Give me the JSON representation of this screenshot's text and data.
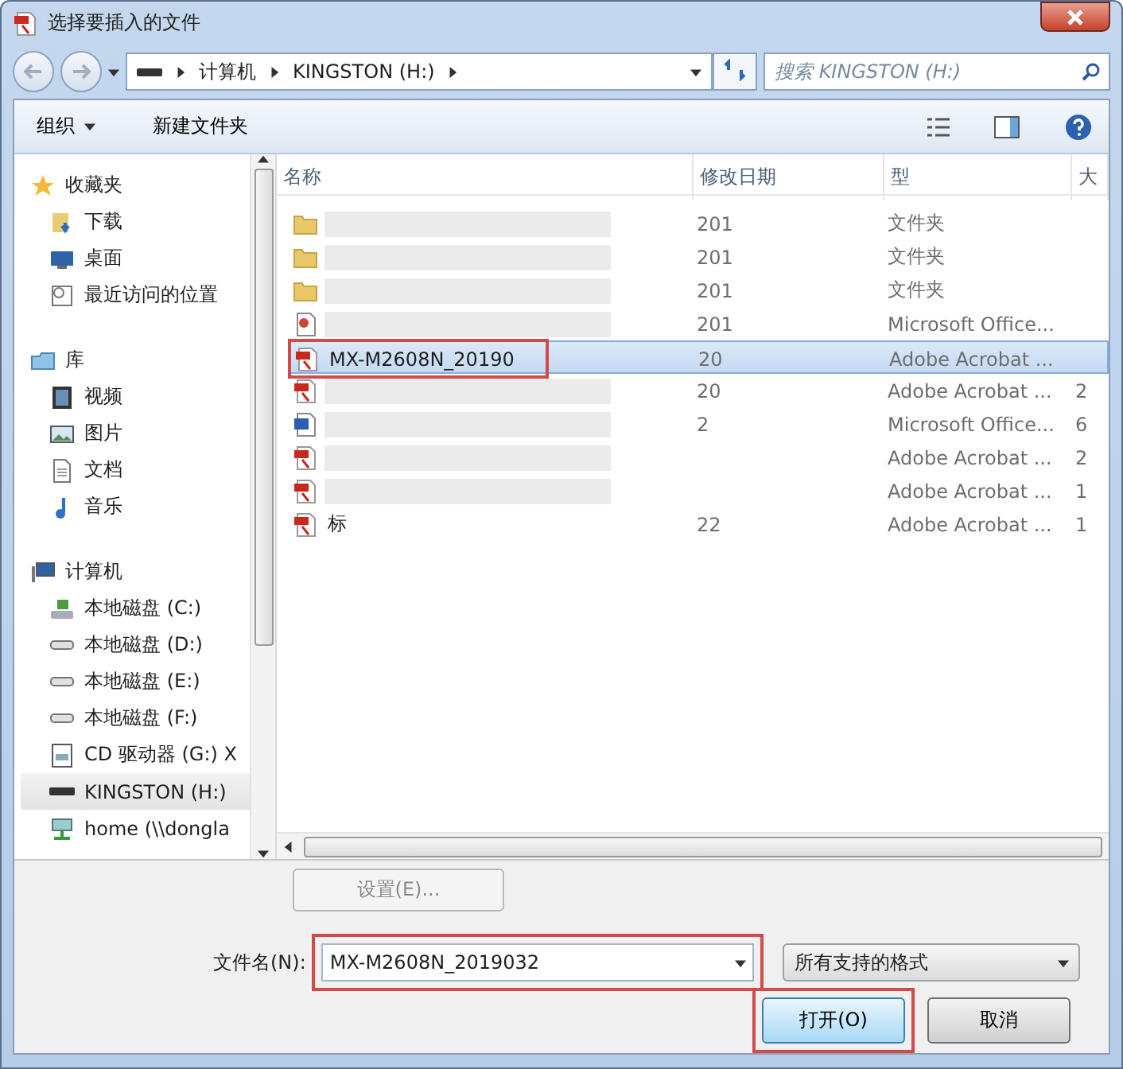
{
  "window": {
    "title": "选择要插入的文件"
  },
  "address": {
    "segments": [
      "计算机",
      "KINGSTON (H:)"
    ]
  },
  "search": {
    "placeholder": "搜索 KINGSTON (H:)"
  },
  "toolbar": {
    "organize": "组织",
    "new_folder": "新建文件夹"
  },
  "sidebar": {
    "groups": [
      {
        "label": "收藏夹",
        "kind": "star",
        "children": [
          {
            "label": "下载",
            "kind": "download",
            "selected": false
          },
          {
            "label": "桌面",
            "kind": "desktop",
            "selected": false
          },
          {
            "label": "最近访问的位置",
            "kind": "recent",
            "selected": false
          }
        ]
      },
      {
        "label": "库",
        "kind": "library",
        "children": [
          {
            "label": "视频",
            "kind": "video",
            "selected": false
          },
          {
            "label": "图片",
            "kind": "picture",
            "selected": false
          },
          {
            "label": "文档",
            "kind": "document",
            "selected": false
          },
          {
            "label": "音乐",
            "kind": "music",
            "selected": false
          }
        ]
      },
      {
        "label": "计算机",
        "kind": "computer",
        "children": [
          {
            "label": "本地磁盘 (C:)",
            "kind": "system-drive",
            "selected": false
          },
          {
            "label": "本地磁盘 (D:)",
            "kind": "drive",
            "selected": false
          },
          {
            "label": "本地磁盘 (E:)",
            "kind": "drive",
            "selected": false
          },
          {
            "label": "本地磁盘 (F:)",
            "kind": "drive",
            "selected": false
          },
          {
            "label": "CD 驱动器 (G:) X",
            "kind": "cd",
            "selected": false
          },
          {
            "label": "KINGSTON (H:)",
            "kind": "usb",
            "selected": true
          },
          {
            "label": "home (\\\\dongla",
            "kind": "network",
            "selected": false
          }
        ]
      }
    ]
  },
  "table": {
    "columns": [
      "名称",
      "修改日期",
      "型",
      "大"
    ],
    "rows": [
      {
        "kind": "folder",
        "name": "",
        "date": "201",
        "type": "文件夹",
        "size": "",
        "selected": false,
        "highlighted": false
      },
      {
        "kind": "folder",
        "name": "",
        "date": "201",
        "type": "文件夹",
        "size": "",
        "selected": false,
        "highlighted": false
      },
      {
        "kind": "folder",
        "name": "",
        "date": "201",
        "type": "文件夹",
        "size": "",
        "selected": false,
        "highlighted": false
      },
      {
        "kind": "ppt",
        "name": "",
        "date": "201",
        "type": "Microsoft Office...",
        "size": "",
        "selected": false,
        "highlighted": false
      },
      {
        "kind": "pdf",
        "name": "MX-M2608N_20190",
        "date": "20",
        "type": "Adobe Acrobat ...",
        "size": "",
        "selected": true,
        "highlighted": true
      },
      {
        "kind": "pdf",
        "name": "",
        "date": "20",
        "type": "Adobe Acrobat ...",
        "size": "2",
        "selected": false,
        "highlighted": false
      },
      {
        "kind": "word",
        "name": "",
        "date": "2",
        "type": "Microsoft Office...",
        "size": "6",
        "selected": false,
        "highlighted": false
      },
      {
        "kind": "pdf",
        "name": "",
        "date": "",
        "type": "Adobe Acrobat ...",
        "size": "2",
        "selected": false,
        "highlighted": false
      },
      {
        "kind": "pdf",
        "name": "",
        "date": "",
        "type": "Adobe Acrobat ...",
        "size": "1",
        "selected": false,
        "highlighted": false
      },
      {
        "kind": "pdf",
        "name": "标",
        "date": "22",
        "type": "Adobe Acrobat ...",
        "size": "1",
        "selected": false,
        "highlighted": false
      }
    ]
  },
  "settings_button": {
    "label": "设置(E)...",
    "disabled": true
  },
  "file_name": {
    "label": "文件名(N):",
    "value": "MX-M2608N_2019032",
    "highlighted": true
  },
  "file_type": {
    "value": "所有支持的格式"
  },
  "buttons": [
    {
      "label": "打开(O)",
      "kind": "primary",
      "highlighted": true
    },
    {
      "label": "取消",
      "kind": "normal",
      "highlighted": false
    }
  ]
}
